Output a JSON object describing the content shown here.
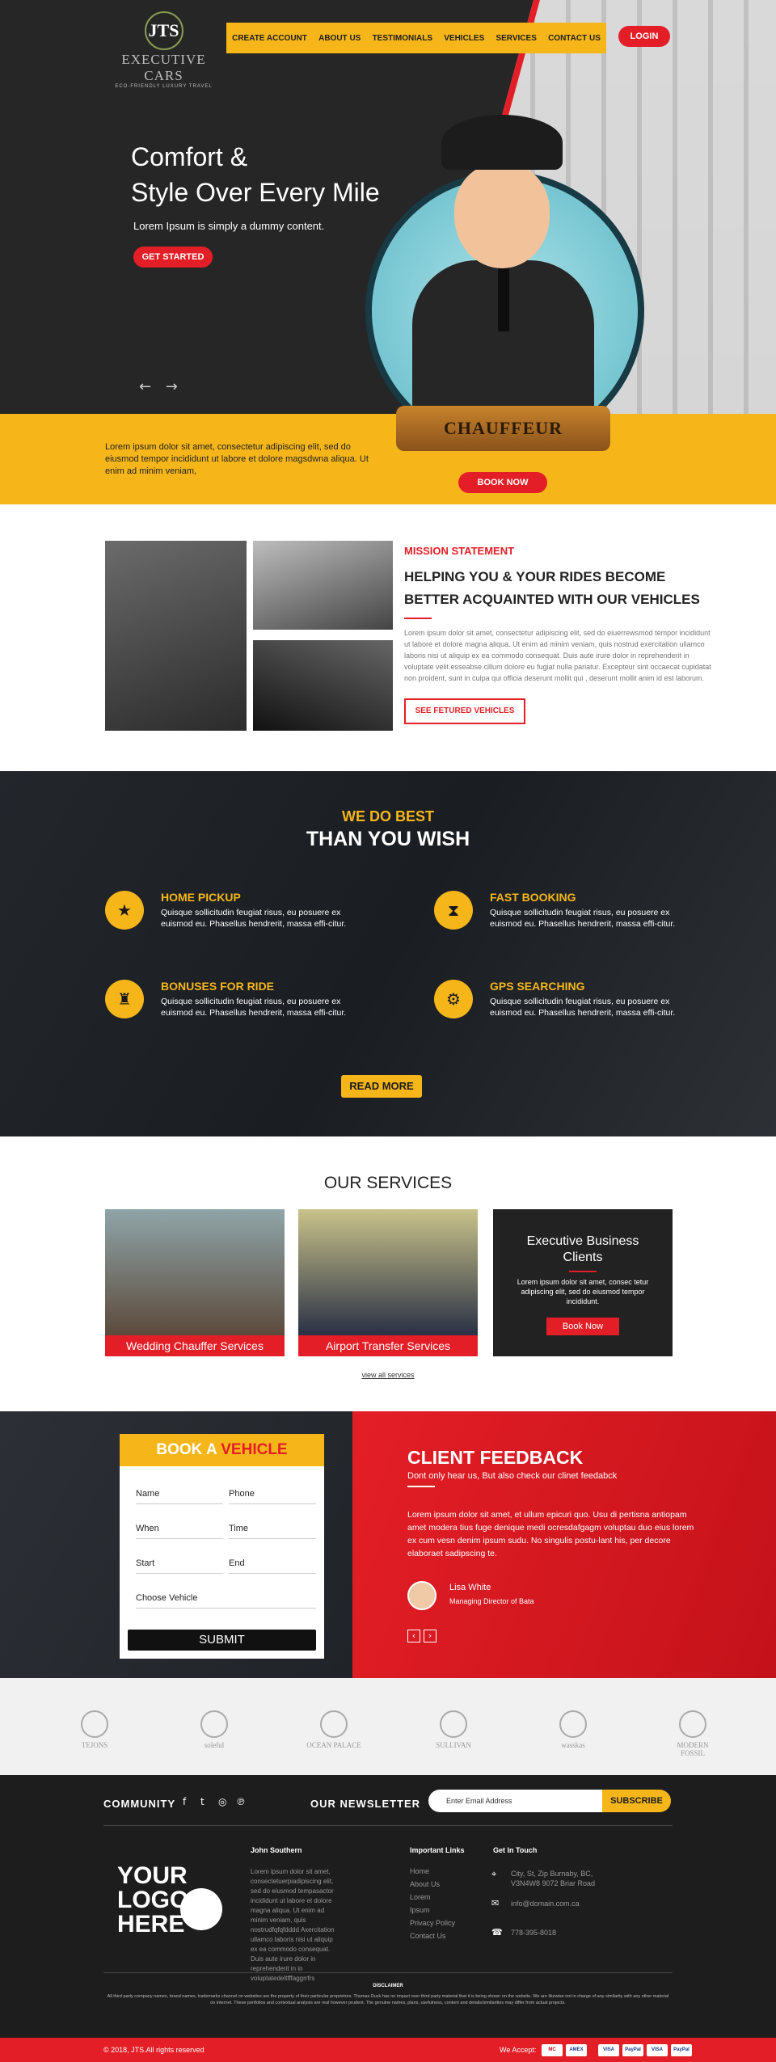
{
  "header": {
    "logo_mono": "JTS",
    "logo_name": "EXECUTIVE CARS",
    "logo_tagline": "ECO-FRIENDLY LUXURY TRAVEL",
    "nav": [
      "CREATE ACCOUNT",
      "ABOUT US",
      "TESTIMONIALS",
      "VEHICLES",
      "SERVICES",
      "CONTACT US"
    ],
    "login": "LOGIN"
  },
  "hero": {
    "title_line1": "Comfort &",
    "title_line2": "Style Over Every Mile",
    "subtitle": "Lorem Ipsum is simply a dummy content.",
    "cta": "GET STARTED",
    "arrows": "← →",
    "band_text": "Lorem ipsum dolor sit amet, consectetur adipiscing elit, sed do eiusmod tempor incididunt ut labore et dolore magsdwna aliqua. Ut enim ad minim veniam,",
    "badge": "CHAUFFEUR",
    "book_now": "BOOK NOW"
  },
  "about": {
    "label": "MISSION STATEMENT",
    "heading": "HELPING YOU & YOUR RIDES BECOME BETTER ACQUAINTED WITH OUR VEHICLES",
    "body": "Lorem ipsum dolor sit amet, consectetur adipiscing elit, sed do eiuerrewsmod tempor incididunt ut labore et dolore magna aliqua. Ut enim ad minim veniam, quis nostrud exercitation ullamco laboris nisi ut aliquip ex ea commodo consequat. Duis aute irure dolor in reprehenderit in voluptate velit esseabse cillum dolore eu fugiat nulla pariatur. Excepteur sint occaecat cupidatat non proident, sunt in culpa qui officia deserunt mollit qui , deserunt mollit anim id est laborum.",
    "cta": "SEE FETURED VEHICLES"
  },
  "best": {
    "title_yellow": "WE DO BEST",
    "title_white": "THAN YOU WISH",
    "features": [
      {
        "icon": "★",
        "title": "HOME PICKUP",
        "text": "Quisque sollicitudin feugiat risus, eu posuere ex euismod eu. Phasellus hendrerit, massa effi-citur."
      },
      {
        "icon": "⧗",
        "title": "FAST BOOKING",
        "text": "Quisque sollicitudin feugiat risus, eu posuere ex euismod eu. Phasellus hendrerit, massa effi-citur."
      },
      {
        "icon": "♜",
        "title": "BONUSES FOR RIDE",
        "text": "Quisque sollicitudin feugiat risus, eu posuere ex euismod eu. Phasellus hendrerit, massa effi-citur."
      },
      {
        "icon": "⚙",
        "title": "GPS SEARCHING",
        "text": "Quisque sollicitudin feugiat risus, eu posuere ex euismod eu. Phasellus hendrerit, massa effi-citur."
      }
    ],
    "read_more": "READ MORE"
  },
  "services": {
    "heading": "OUR SERVICES",
    "cards": [
      "Wedding Chauffer Services",
      "Airport Transfer Services"
    ],
    "featured": {
      "title_line1": "Executive Business",
      "title_line2": "Clients",
      "text": "Lorem ipsum dolor sit amet, consec tetur adipiscing elit, sed do eiusmod tempor incididunt.",
      "button": "Book Now"
    },
    "view_all": "view all services"
  },
  "booking": {
    "title_a": "BOOK A ",
    "title_b": "VEHICLE",
    "fields": {
      "name": "Name",
      "phone": "Phone",
      "when": "When",
      "time": "Time",
      "start": "Start",
      "end": "End",
      "vehicle": "Choose Vehicle"
    },
    "submit": "SUBMIT"
  },
  "feedback": {
    "title": "CLIENT FEEDBACK",
    "subtitle": "Dont only hear us, But also check our clinet feedabck",
    "quote": "Lorem ipsum dolor sit amet, et ullum epicuri quo. Usu di pertisna antiopam amet modera tius fuge denique medi ocresdafgagm voluptau duo eius lorem ex cum vesn denim ipsum sudu. No singulis postu-lant his, per decore elaboraet sadipscing te.",
    "name": "Lisa White",
    "role": "Managing Director of  Bata",
    "prev": "‹",
    "next": "›"
  },
  "brands": [
    "TEJONS",
    "soleful",
    "OCEAN PALACE",
    "SULLIVAN",
    "wasskas",
    "MODERN FOSSIL"
  ],
  "footer": {
    "community": "COMMUNITY",
    "social_icons": [
      "facebook-icon",
      "twitter-icon",
      "instagram-icon",
      "pinterest-icon"
    ],
    "newsletter": "OUR NEWSLETTER",
    "email_placeholder": "Enter Email Address",
    "subscribe": "SUBSCRIBE",
    "logo_line1": "YOUR",
    "logo_line2": "LOGO",
    "logo_line3": "HERE",
    "col1_title": "John Southern",
    "col1_text": "Lorem ipsum dolor sit amet, consectetuerpiadipiscing elit, sed do eiusmod tempasactor incididunt ut labore et dolore magna aliqua. Ut enim ad minim veniam, quis nostrudfqfqfdddd Axercitation ullamco laboris nisi ut aliquip ex ea commodo consequat. Duis aute irure dolor in reprehenderit in in voluptatedeltfffaggrrfrs",
    "col2_title": "Important Links",
    "links": [
      "Home",
      "About Us",
      "Lorem",
      "Ipsum",
      "Privacy Policy",
      "Contact Us"
    ],
    "col3_title": "Get In Touch",
    "address": "City, St, Zip Burnaby, BC, V3N4W8 9072 Briar Road",
    "email": "info@domain.com.ca",
    "phone": "778-395-8018",
    "disclaimer_title": "DISCLAIMER",
    "disclaimer": "All third party company names, brand names, trademarks channel on websites are the property of their particular proprietors. Thomas Duck has no impact over third party material that it is being shown on the website. We are likewise not in charge of any similarity with any other material on internet. These portfolios and contextual analysis are real however prudent. The genuine names, plans, usefulness, content and details/similarities may differ from actual projects.",
    "copyright": "© 2018, JTS.All rights reserved",
    "we_accept": "We Accept:",
    "cards": [
      "MC",
      "AMEX",
      "VISA",
      "PayPal",
      "VISA",
      "PayPal"
    ]
  },
  "colors": {
    "accent": "#f6b61a",
    "brand_red": "#e41e26",
    "dark": "#1d1d1d"
  }
}
